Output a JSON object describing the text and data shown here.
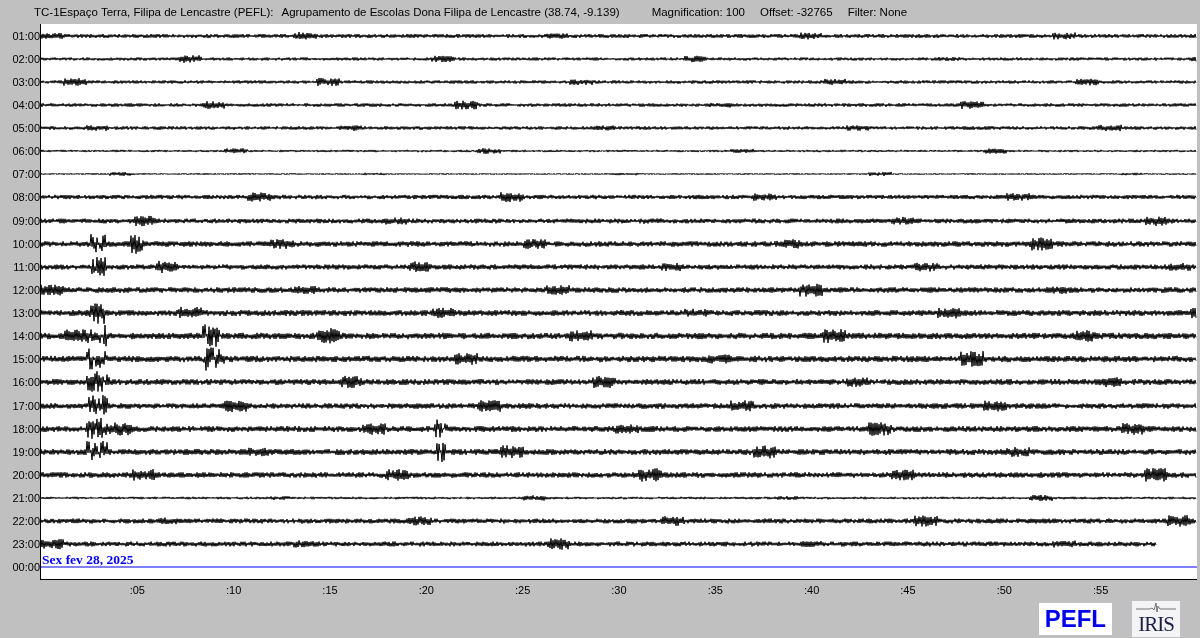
{
  "header": {
    "station": "TC-1Espaço Terra, Filipa de Lencastre (PEFL):",
    "site": "Agrupamento de Escolas Dona Filipa de Lencastre (38.74, -9.139)",
    "magnification": "Magnification: 100",
    "offset": "Offset: -32765",
    "filter": "Filter: None"
  },
  "rows": [
    {
      "label": "01:00",
      "kind": "full"
    },
    {
      "label": "02:00",
      "kind": "full"
    },
    {
      "label": "03:00",
      "kind": "full"
    },
    {
      "label": "04:00",
      "kind": "full"
    },
    {
      "label": "05:00",
      "kind": "full"
    },
    {
      "label": "06:00",
      "kind": "full"
    },
    {
      "label": "07:00",
      "kind": "full"
    },
    {
      "label": "08:00",
      "kind": "full"
    },
    {
      "label": "09:00",
      "kind": "full"
    },
    {
      "label": "10:00",
      "kind": "full"
    },
    {
      "label": "11:00",
      "kind": "full"
    },
    {
      "label": "12:00",
      "kind": "full"
    },
    {
      "label": "13:00",
      "kind": "full"
    },
    {
      "label": "14:00",
      "kind": "full"
    },
    {
      "label": "15:00",
      "kind": "full"
    },
    {
      "label": "16:00",
      "kind": "full"
    },
    {
      "label": "17:00",
      "kind": "full"
    },
    {
      "label": "18:00",
      "kind": "full"
    },
    {
      "label": "19:00",
      "kind": "full"
    },
    {
      "label": "20:00",
      "kind": "full"
    },
    {
      "label": "21:00",
      "kind": "full"
    },
    {
      "label": "22:00",
      "kind": "full"
    },
    {
      "label": "23:00",
      "kind": "partial"
    },
    {
      "label": "00:00",
      "kind": "current",
      "date": "Sex fev 28, 2025"
    }
  ],
  "x_ticks": [
    ":05",
    ":10",
    ":15",
    ":20",
    ":25",
    ":30",
    ":35",
    ":40",
    ":45",
    ":50",
    ":55"
  ],
  "logos": {
    "station": "PEFL",
    "network": "IRIS"
  }
}
